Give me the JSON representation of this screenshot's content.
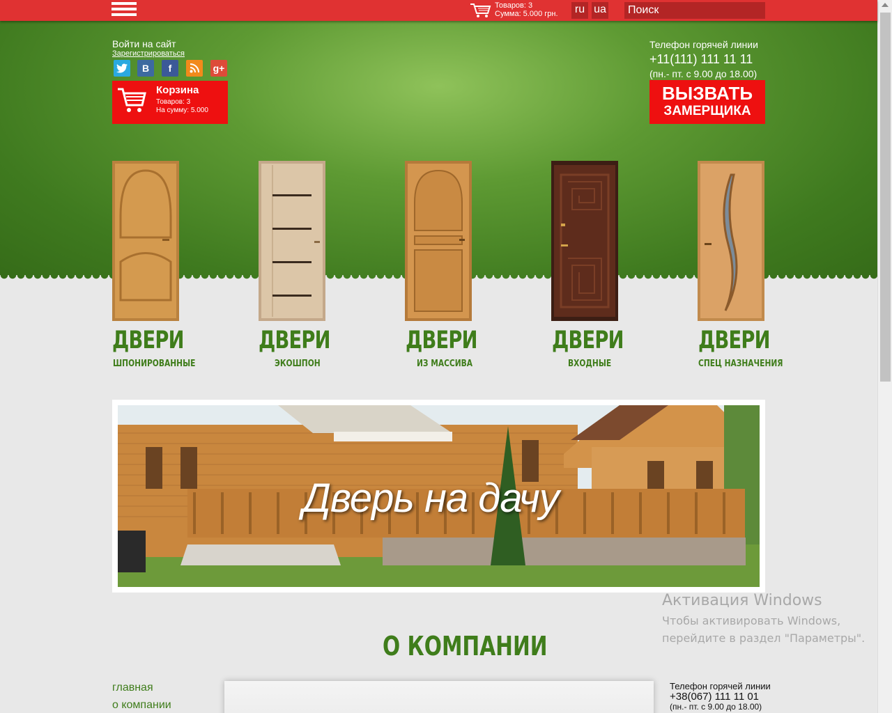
{
  "topbar": {
    "menu_icon": "hamburger-menu-icon",
    "mini_cart": {
      "items_text": "Товаров: 3",
      "sum_text": "Сумма: 5.000 грн."
    },
    "languages": [
      "ru",
      "ua"
    ],
    "search_placeholder": "Поиск"
  },
  "header": {
    "login": "Войти на сайт",
    "register": "Зарегистрироваться",
    "social_icons": [
      "twitter-icon",
      "vk-icon",
      "facebook-icon",
      "rss-icon",
      "google-plus-icon"
    ],
    "cart": {
      "title": "Корзина",
      "items": "Товаров: 3",
      "sum": "На сумму: 5.000"
    },
    "hotline": {
      "label": "Телефон горячей линии",
      "phone": "+11(111) 111 11 11",
      "hours": "(пн.- пт. с 9.00 до 18.00)"
    },
    "call_button": {
      "line1": "ВЫЗВАТЬ",
      "line2": "ЗАМЕРЩИКА"
    }
  },
  "categories": [
    {
      "title": "ДВЕРИ",
      "subtitle": "ШПОНИРОВАННЫЕ"
    },
    {
      "title": "ДВЕРИ",
      "subtitle": "ЭКОШПОН"
    },
    {
      "title": "ДВЕРИ",
      "subtitle": "ИЗ МАССИВА"
    },
    {
      "title": "ДВЕРИ",
      "subtitle": "ВХОДНЫЕ"
    },
    {
      "title": "ДВЕРИ",
      "subtitle": "СПЕЦ НАЗНАЧЕНИЯ"
    }
  ],
  "banner": {
    "caption": "Дверь на дачу"
  },
  "about": {
    "title": "О КОМПАНИИ",
    "nav": [
      "главная",
      "о компании"
    ],
    "hotline": {
      "label": "Телефон горячей линии",
      "phone": "+38(067) 111 11 01",
      "hours": "(пн.- пт. с 9.00 до 18.00)"
    }
  },
  "watermark": {
    "title": "Активация Windows",
    "line1": "Чтобы активировать Windows,",
    "line2": "перейдите в раздел \"Параметры\"."
  },
  "colors": {
    "topbar": "#e03232",
    "accent_red": "#ee1010",
    "green": "#3f7d1b"
  }
}
